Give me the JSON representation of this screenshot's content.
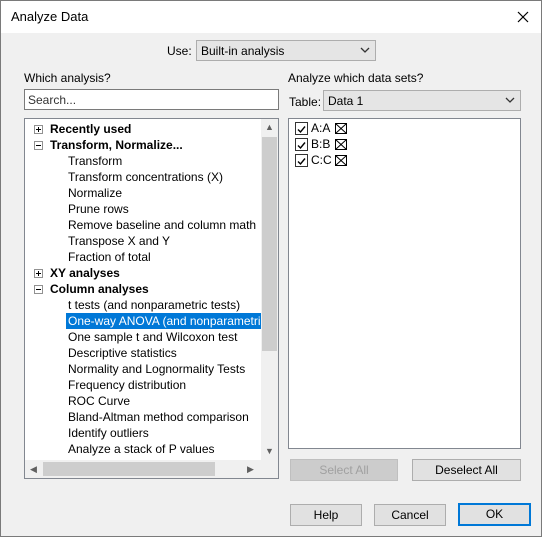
{
  "window": {
    "title": "Analyze Data",
    "close_glyph": "✕"
  },
  "use": {
    "label": "Use:",
    "value": "Built-in analysis"
  },
  "which_analysis": {
    "label": "Which analysis?",
    "search_placeholder": "Search...",
    "tree": [
      {
        "label": "Recently used",
        "kind": "category",
        "expander": "+"
      },
      {
        "label": "Transform, Normalize...",
        "kind": "category",
        "expander": "−"
      },
      {
        "label": "Transform",
        "kind": "item"
      },
      {
        "label": "Transform concentrations (X)",
        "kind": "item"
      },
      {
        "label": "Normalize",
        "kind": "item"
      },
      {
        "label": "Prune rows",
        "kind": "item"
      },
      {
        "label": "Remove baseline and column math",
        "kind": "item"
      },
      {
        "label": "Transpose X and Y",
        "kind": "item"
      },
      {
        "label": "Fraction of total",
        "kind": "item"
      },
      {
        "label": "XY analyses",
        "kind": "category",
        "expander": "+"
      },
      {
        "label": "Column analyses",
        "kind": "category",
        "expander": "−"
      },
      {
        "label": "t tests (and nonparametric tests)",
        "kind": "item"
      },
      {
        "label": "One-way ANOVA (and nonparametric or",
        "kind": "item",
        "selected": true
      },
      {
        "label": "One sample t and Wilcoxon test",
        "kind": "item"
      },
      {
        "label": "Descriptive statistics",
        "kind": "item"
      },
      {
        "label": "Normality and Lognormality Tests",
        "kind": "item"
      },
      {
        "label": "Frequency distribution",
        "kind": "item"
      },
      {
        "label": "ROC Curve",
        "kind": "item"
      },
      {
        "label": "Bland-Altman method comparison",
        "kind": "item"
      },
      {
        "label": "Identify outliers",
        "kind": "item"
      },
      {
        "label": "Analyze a stack of P values",
        "kind": "item"
      }
    ]
  },
  "datasets": {
    "label": "Analyze which data sets?",
    "table_label": "Table:",
    "table_value": "Data 1",
    "items": [
      {
        "label": "A:A",
        "checked": true
      },
      {
        "label": "B:B",
        "checked": true
      },
      {
        "label": "C:C",
        "checked": true
      }
    ]
  },
  "buttons": {
    "select_all": "Select All",
    "deselect_all": "Deselect All",
    "help": "Help",
    "cancel": "Cancel",
    "ok": "OK"
  },
  "colors": {
    "selection": "#0078d7",
    "dialog_bg": "#f0f0f0"
  }
}
